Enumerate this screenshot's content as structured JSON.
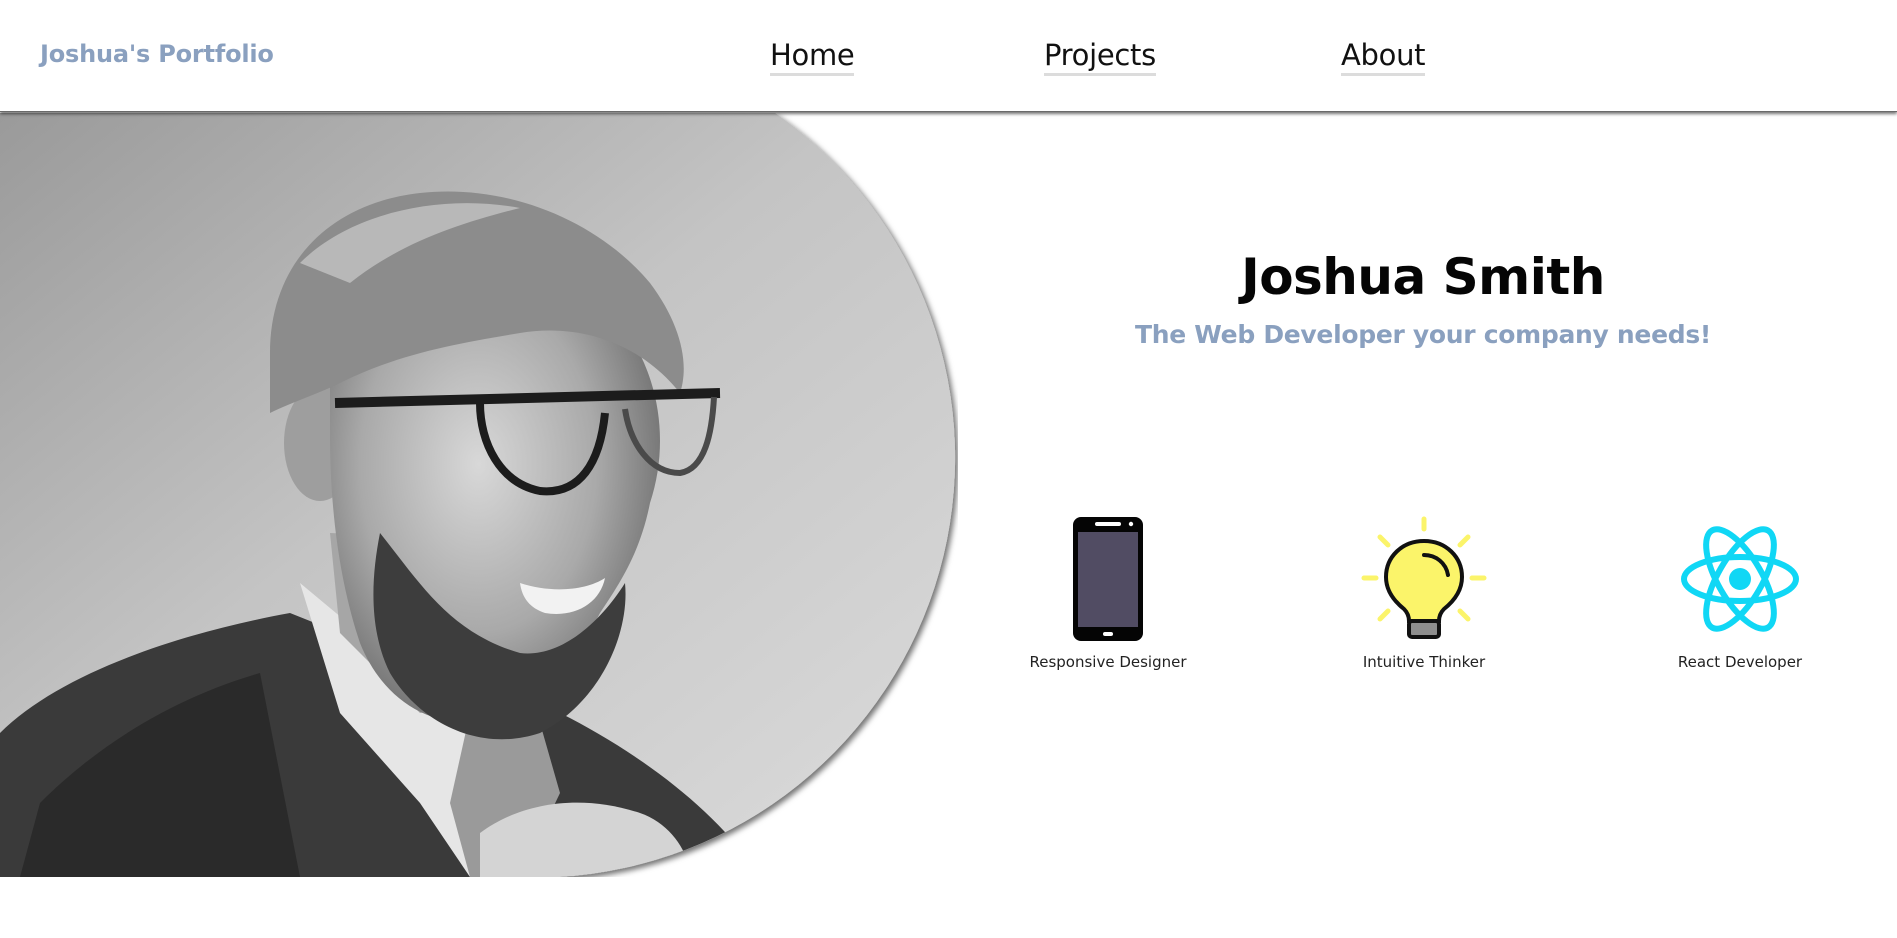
{
  "brand": {
    "title": "Joshua's Portfolio"
  },
  "nav": {
    "items": [
      "Home",
      "Projects",
      "About"
    ]
  },
  "hero": {
    "photo_alt": "grayscale portrait photo",
    "name": "Joshua Smith",
    "tagline": "The Web Developer your company needs!"
  },
  "skills": [
    {
      "label": "Responsive Designer",
      "icon": "smartphone-icon"
    },
    {
      "label": "Intuitive Thinker",
      "icon": "lightbulb-icon"
    },
    {
      "label": "React Developer",
      "icon": "react-atom-icon"
    }
  ],
  "colors": {
    "accent": "#8aa0bf",
    "react": "#10d7f5",
    "bulb": "#fbf46a",
    "phone_screen": "#514c63"
  }
}
